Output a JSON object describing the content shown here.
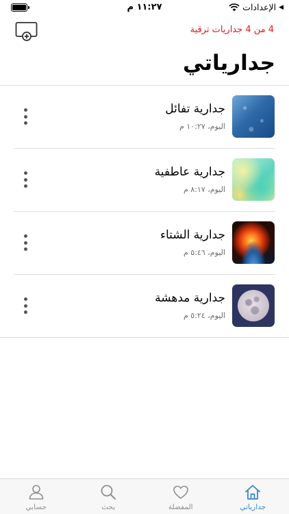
{
  "status_bar": {
    "back_app_label": "الإعدادات",
    "time": "١١:٢٧ م"
  },
  "header": {
    "upgrade_text": "4 من 4 جداريات ترقية",
    "title": "جدارياتي"
  },
  "walls": [
    {
      "name": "جدارية تفائل",
      "date": "اليوم، ١٠:٢٧ م"
    },
    {
      "name": "جدارية عاطفية",
      "date": "اليوم، ٨:١٧ م"
    },
    {
      "name": "جدارية الشتاء",
      "date": "اليوم، ٥:٤٦ م"
    },
    {
      "name": "جدارية مدهشة",
      "date": "اليوم، ٥:٢٤ م"
    }
  ],
  "tabs": [
    {
      "label": "جدارياتي",
      "icon": "home-icon",
      "active": true
    },
    {
      "label": "المفضلة",
      "icon": "heart-icon",
      "active": false
    },
    {
      "label": "بحث",
      "icon": "search-icon",
      "active": false
    },
    {
      "label": "حسابي",
      "icon": "person-icon",
      "active": false
    }
  ],
  "colors": {
    "accent": "#3a86c8",
    "upgrade": "#e0181b"
  },
  "battery_level": 1.0
}
